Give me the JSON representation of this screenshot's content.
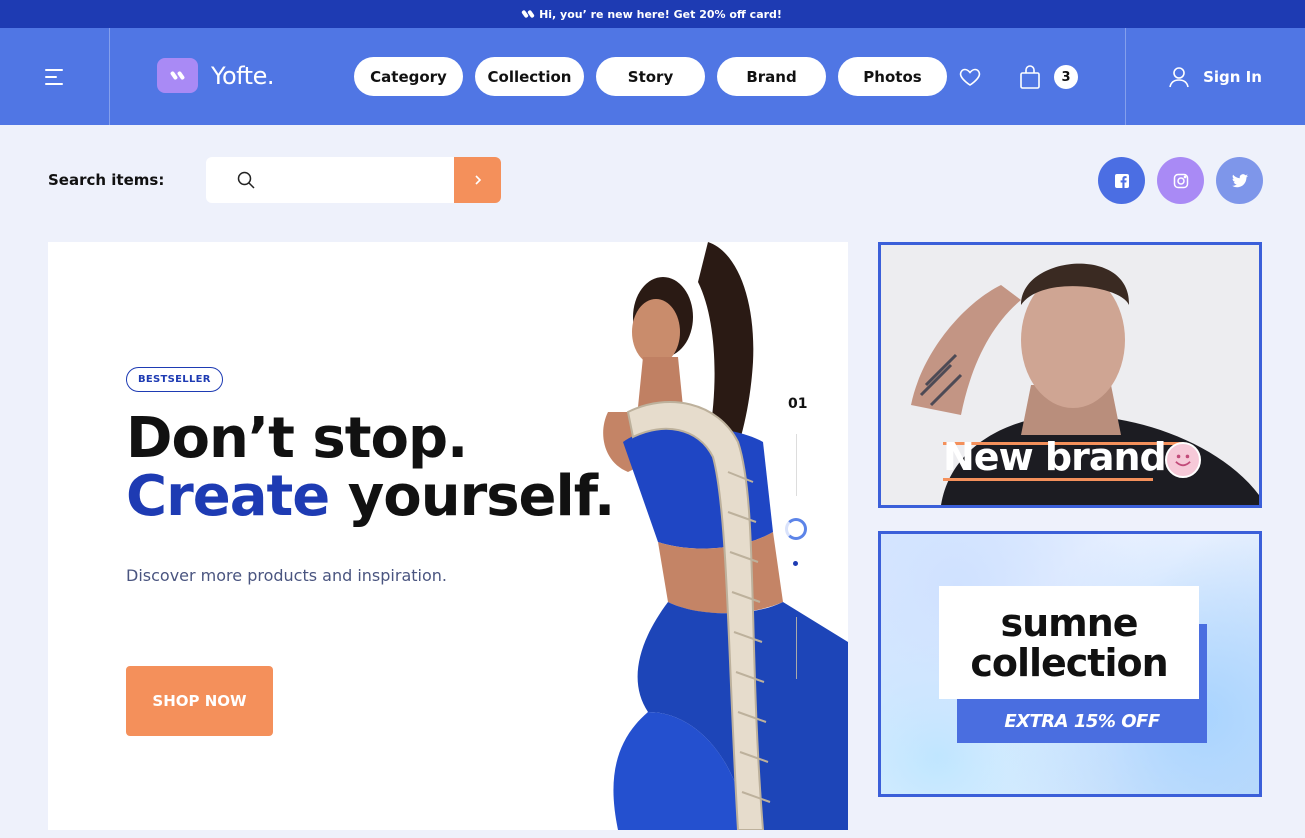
{
  "announcement": {
    "text": "Hi, you’ re new here! Get 20% off card!"
  },
  "header": {
    "brand": "Yofte.",
    "nav": [
      "Category",
      "Collection",
      "Story",
      "Brand",
      "Photos"
    ],
    "cart_count": "3",
    "signin_label": "Sign In"
  },
  "search": {
    "label": "Search items:",
    "placeholder": ""
  },
  "hero": {
    "badge": "BESTSELLER",
    "headline_line1": "Don’t stop.",
    "headline_accent": "Create",
    "headline_rest": " yourself.",
    "subline": "Discover more products and inspiration.",
    "cta": "SHOP NOW",
    "slide_number": "01"
  },
  "promos": {
    "promo1_title": "New brand",
    "promo2_line1": "sumne",
    "promo2_line2": "collection",
    "promo2_offer": "EXTRA 15% OFF"
  },
  "colors": {
    "announcement_bg": "#1e3bb3",
    "header_bg": "#5076e4",
    "accent_blue": "#1e3bb3",
    "accent_orange": "#f4905b",
    "brand_purple": "#a98af5"
  },
  "icons": [
    "menu-icon",
    "logo-mark-icon",
    "heart-icon",
    "shopping-bag-icon",
    "user-icon",
    "search-icon",
    "chevron-right-icon",
    "facebook-icon",
    "instagram-icon",
    "twitter-icon",
    "smiley-icon"
  ]
}
